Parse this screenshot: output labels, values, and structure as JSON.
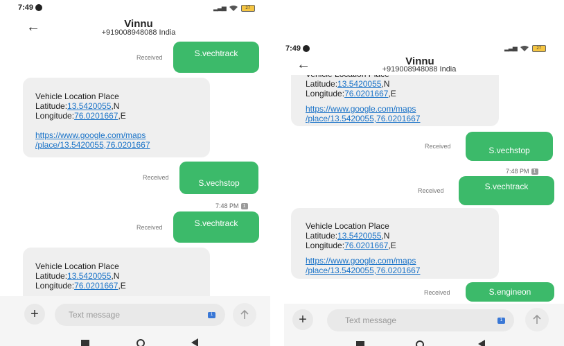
{
  "status": {
    "time": "7:49",
    "battery": "27"
  },
  "header": {
    "contact_name": "Vinnu",
    "contact_number": "+919008948088 India"
  },
  "labels": {
    "received": "Received",
    "timestamp": "7:48 PM",
    "badge": "1"
  },
  "bubbles": {
    "vechtrack": "S.vechtrack",
    "vechstop": "S.vechstop",
    "engineon": "S.engineon"
  },
  "location": {
    "title": "Vehicle Location Place",
    "lat_label": "Latitude:",
    "lat_value": "13.5420055",
    "lat_dir": ",N",
    "lon_label": "Longitude:",
    "lon_value": "76.0201667",
    "lon_dir": ",E",
    "url_line1": "https://www.google.com/maps",
    "url_line2": "/place/13.5420055,76.0201667"
  },
  "compose": {
    "placeholder": "Text message"
  }
}
